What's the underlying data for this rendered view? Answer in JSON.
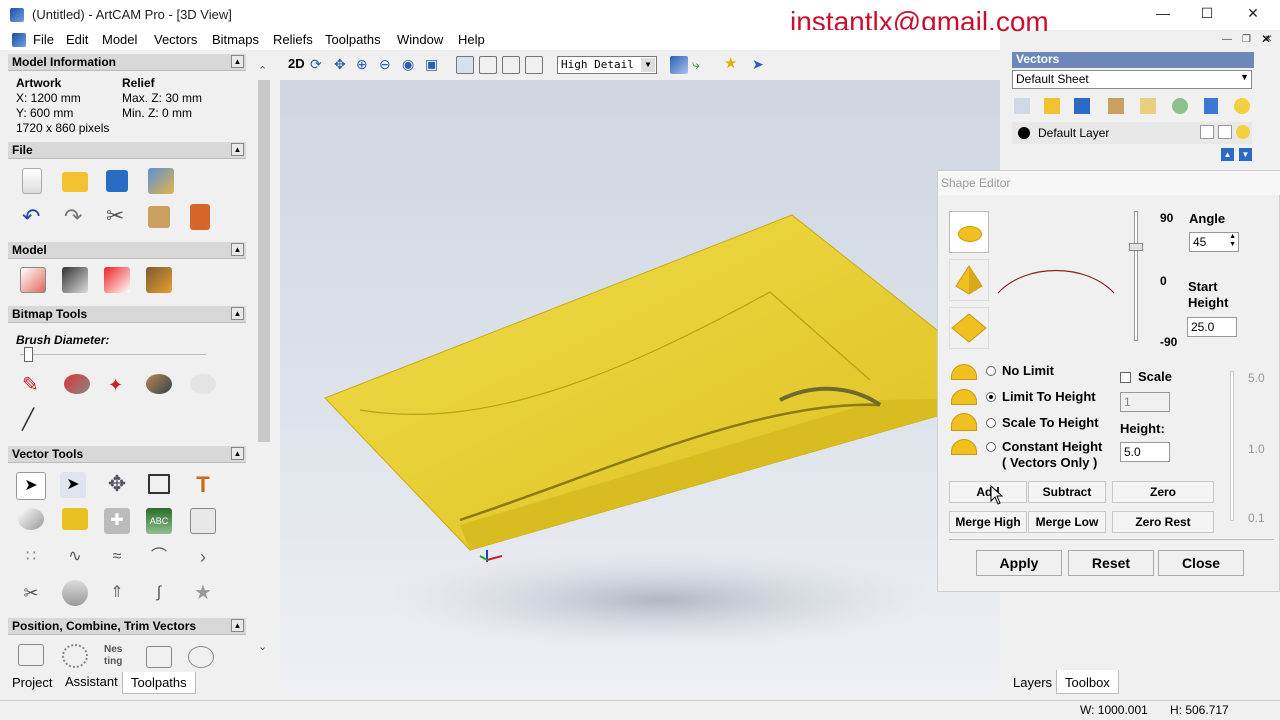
{
  "window": {
    "title": "(Untitled) - ArtCAM Pro - [3D View]",
    "overlay_email": "instantlx@gmail.com"
  },
  "menu": [
    "File",
    "Edit",
    "Model",
    "Vectors",
    "Bitmaps",
    "Reliefs",
    "Toolpaths",
    "Window",
    "Help"
  ],
  "model_info": {
    "header": "Model Information",
    "artwork_label": "Artwork",
    "relief_label": "Relief",
    "x": "X: 1200 mm",
    "y": "Y: 600 mm",
    "pixels": "1720 x 860 pixels",
    "max_z": "Max. Z: 30 mm",
    "min_z": "Min. Z: 0 mm"
  },
  "sections": {
    "file": "File",
    "model": "Model",
    "bitmap_tools": "Bitmap Tools",
    "brush_diameter": "Brush Diameter:",
    "vector_tools": "Vector Tools",
    "position": "Position, Combine, Trim Vectors"
  },
  "left_tabs": [
    "Project",
    "Assistant",
    "Toolpaths"
  ],
  "toolbar": {
    "mode_2d": "2D",
    "detail_select": "High Detail"
  },
  "vectors_panel": {
    "header": "Vectors",
    "sheet": "Default Sheet",
    "layer": "Default Layer"
  },
  "right_tabs": [
    "Layers",
    "Toolbox"
  ],
  "shape_editor": {
    "title": "Shape Editor",
    "angle_label": "Angle",
    "angle_value": "45",
    "scale_90": "90",
    "scale_0": "0",
    "scale_neg90": "-90",
    "start_height_label": "Start Height",
    "start_height_value": "25.0",
    "no_limit": "No Limit",
    "limit_to_height": "Limit To Height",
    "scale_to_height": "Scale To Height",
    "constant_height": "Constant Height",
    "vectors_only": "( Vectors Only )",
    "scale_label": "Scale",
    "scale_value": "1",
    "height_label": "Height:",
    "height_value": "5.0",
    "slider_top": "5.0",
    "slider_mid": "1.0",
    "slider_bot": "0.1",
    "add": "Add",
    "subtract": "Subtract",
    "zero": "Zero",
    "merge_high": "Merge High",
    "merge_low": "Merge Low",
    "zero_rest": "Zero Rest",
    "apply": "Apply",
    "reset": "Reset",
    "close": "Close"
  },
  "status": {
    "w": "W: 1000.001",
    "h": "H: 506.717"
  }
}
